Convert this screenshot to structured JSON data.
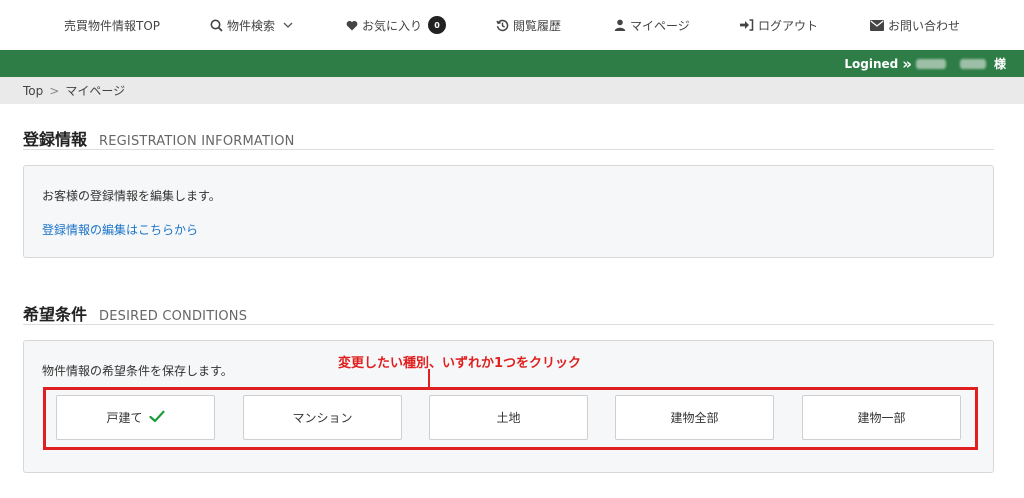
{
  "nav": {
    "top_label": "売買物件情報TOP",
    "search_label": "物件検索",
    "favorites_label": "お気に入り",
    "favorites_count": "0",
    "history_label": "閲覧履歴",
    "mypage_label": "マイページ",
    "logout_label": "ログアウト",
    "contact_label": "お問い合わせ"
  },
  "user_bar": {
    "logined_label": "Logined",
    "arrow": "»",
    "honorific": "様"
  },
  "breadcrumb": {
    "top": "Top",
    "separator": ">",
    "current": "マイページ"
  },
  "registration": {
    "title_jp": "登録情報",
    "title_en": "REGISTRATION INFORMATION",
    "description": "お客様の登録情報を編集します。",
    "edit_link": "登録情報の編集はこちらから"
  },
  "conditions": {
    "title_jp": "希望条件",
    "title_en": "DESIRED CONDITIONS",
    "description": "物件情報の希望条件を保存します。",
    "annotation": "変更したい種別、いずれか1つをクリック",
    "types": [
      {
        "label": "戸建て",
        "checked": true
      },
      {
        "label": "マンション",
        "checked": false
      },
      {
        "label": "土地",
        "checked": false
      },
      {
        "label": "建物全部",
        "checked": false
      },
      {
        "label": "建物一部",
        "checked": false
      }
    ]
  },
  "colors": {
    "brand_green": "#2e7d46",
    "link_blue": "#1a73c9",
    "annotation_red": "#e02020",
    "check_green": "#1e9c3c"
  }
}
